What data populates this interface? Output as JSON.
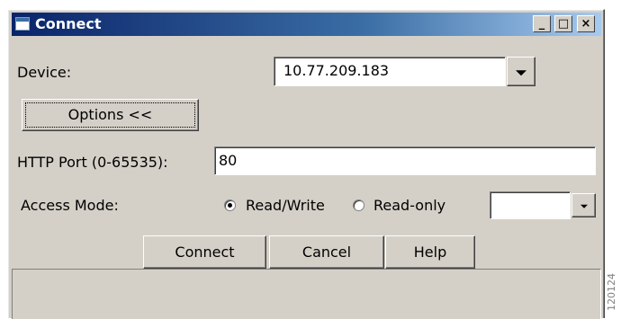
{
  "window": {
    "title": "Connect",
    "controls": {
      "minimize": "_",
      "maximize": "□",
      "close": "×"
    }
  },
  "device": {
    "label": "Device:",
    "value": "10.77.209.183"
  },
  "options_button": {
    "label": "Options <<"
  },
  "http_port": {
    "label": "HTTP Port (0-65535):",
    "value": "80"
  },
  "access_mode": {
    "label": "Access Mode:",
    "options": [
      {
        "label": "Read/Write",
        "selected": true
      },
      {
        "label": "Read-only",
        "selected": false
      }
    ],
    "extra_select_value": ""
  },
  "buttons": {
    "connect": "Connect",
    "cancel": "Cancel",
    "help": "Help"
  },
  "figure_id": "120124"
}
